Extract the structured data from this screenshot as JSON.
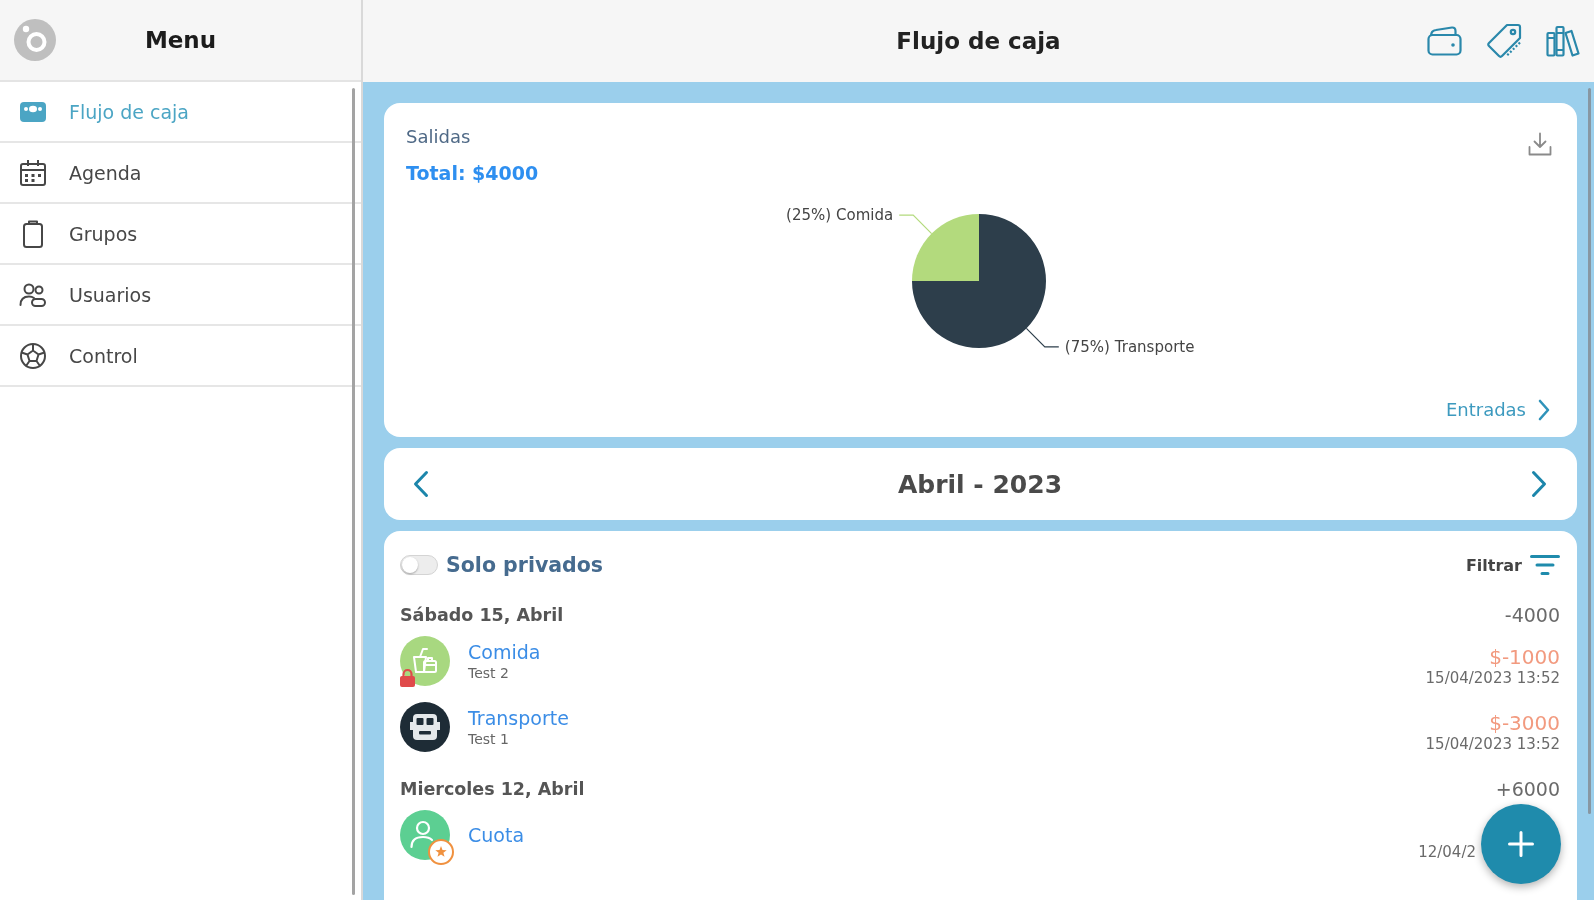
{
  "sidebar": {
    "title": "Menu",
    "items": [
      {
        "label": "Flujo de caja",
        "kind": "cashflow",
        "selected": true
      },
      {
        "label": "Agenda",
        "kind": "calendar",
        "selected": false
      },
      {
        "label": "Grupos",
        "kind": "groups",
        "selected": false
      },
      {
        "label": "Usuarios",
        "kind": "users",
        "selected": false
      },
      {
        "label": "Control",
        "kind": "control",
        "selected": false
      }
    ]
  },
  "header": {
    "title": "Flujo de caja"
  },
  "summary": {
    "title": "Salidas",
    "total": "Total: $4000",
    "chart_data": [
      {
        "type": "pie",
        "categories": [
          "Comida",
          "Transporte"
        ],
        "values": [
          25,
          75
        ],
        "colors": [
          "#b3da7d",
          "#2d3e4b"
        ],
        "value_labels": [
          "(25%)",
          "(75%)"
        ]
      }
    ],
    "link": "Entradas"
  },
  "month_nav": {
    "label": "Abril - 2023"
  },
  "filters": {
    "private_only": {
      "label": "Solo privados",
      "on": false
    },
    "filter_button": "Filtrar"
  },
  "days": [
    {
      "label": "Sábado 15, Abril",
      "total": "-4000",
      "entries": [
        {
          "kind": "food",
          "color": "#a8d880",
          "name": "Comida",
          "note": "Test 2",
          "amount": "$-1000",
          "time": "15/04/2023 13:52",
          "private": true,
          "starred": false
        },
        {
          "kind": "transport",
          "color": "#1e2c36",
          "name": "Transporte",
          "note": "Test 1",
          "amount": "$-3000",
          "time": "15/04/2023 13:52",
          "private": false,
          "starred": false
        }
      ]
    },
    {
      "label": "Miercoles 12, Abril",
      "total": "+6000",
      "entries": [
        {
          "kind": "member",
          "color": "#5ccf92",
          "name": "Cuota",
          "time": "12/04/2",
          "private": false,
          "starred": true
        }
      ]
    }
  ]
}
